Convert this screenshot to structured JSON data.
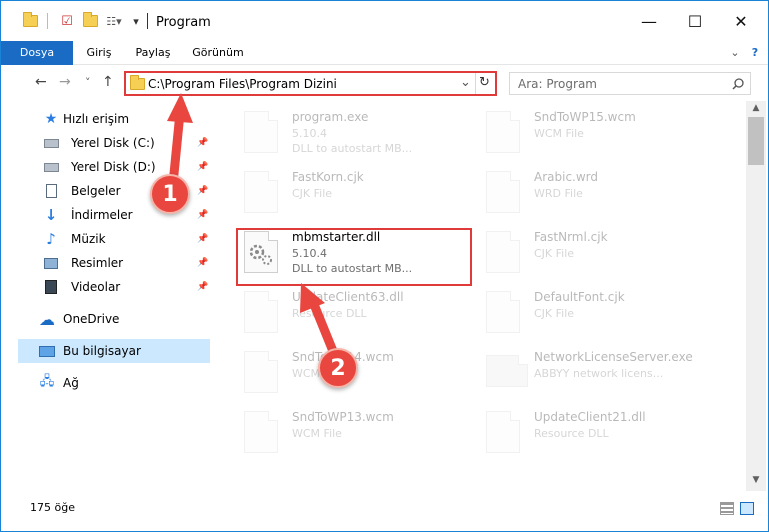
{
  "titlebar": {
    "title": "Program",
    "minimize": "—",
    "maximize": "☐",
    "close": "✕"
  },
  "ribbon": {
    "tabs": [
      "Dosya",
      "Giriş",
      "Paylaş",
      "Görünüm"
    ],
    "expand": "⌄",
    "help": "?"
  },
  "navigation": {
    "back": "←",
    "forward": "→",
    "recent": "˅",
    "up": "↑",
    "address": "C:\\Program Files\\Program Dizini",
    "dropdown": "⌄",
    "refresh": "↻",
    "search_placeholder": "Ara: Program"
  },
  "sidebar": {
    "quick_access": "Hızlı erişim",
    "items": [
      {
        "label": "Yerel Disk (C:)",
        "icon": "drive-icon",
        "pinned": true
      },
      {
        "label": "Yerel Disk (D:)",
        "icon": "drive-icon",
        "pinned": true
      },
      {
        "label": "Belgeler",
        "icon": "documents-icon",
        "pinned": true
      },
      {
        "label": "İndirmeler",
        "icon": "download-icon",
        "pinned": true
      },
      {
        "label": "Müzik",
        "icon": "music-icon",
        "pinned": true
      },
      {
        "label": "Resimler",
        "icon": "pictures-icon",
        "pinned": true
      },
      {
        "label": "Videolar",
        "icon": "videos-icon",
        "pinned": true
      }
    ],
    "onedrive": "OneDrive",
    "this_pc": "Bu bilgisayar",
    "network": "Ağ"
  },
  "files": [
    {
      "name": "program.exe",
      "line2": "5.10.4",
      "line3": "DLL to autostart MB...",
      "faded": true
    },
    {
      "name": "SndToWP15.wcm",
      "line2": "WCM File",
      "line3": "",
      "faded": true
    },
    {
      "name": "FastKorn.cjk",
      "line2": "CJK File",
      "line3": "",
      "faded": true
    },
    {
      "name": "Arabic.wrd",
      "line2": "WRD File",
      "line3": "",
      "faded": true
    },
    {
      "name": "mbmstarter.dll",
      "line2": "5.10.4",
      "line3": "DLL to autostart MB...",
      "faded": false
    },
    {
      "name": "FastNrml.cjk",
      "line2": "CJK File",
      "line3": "",
      "faded": true
    },
    {
      "name": "UpdateClient63.dll",
      "line2": "Resource DLL",
      "line3": "",
      "faded": true
    },
    {
      "name": "DefaultFont.cjk",
      "line2": "CJK File",
      "line3": "",
      "faded": true
    },
    {
      "name": "SndToWP14.wcm",
      "line2": "WCM File",
      "line3": "",
      "faded": true
    },
    {
      "name": "NetworkLicenseServer.exe",
      "line2": "ABBYY network licens...",
      "line3": "",
      "faded": true
    },
    {
      "name": "SndToWP13.wcm",
      "line2": "WCM File",
      "line3": "",
      "faded": true
    },
    {
      "name": "UpdateClient21.dll",
      "line2": "Resource DLL",
      "line3": "",
      "faded": true
    }
  ],
  "status": {
    "count": "175 öğe"
  },
  "annotations": {
    "step1": "1",
    "step2": "2",
    "color": "#e8463f"
  }
}
